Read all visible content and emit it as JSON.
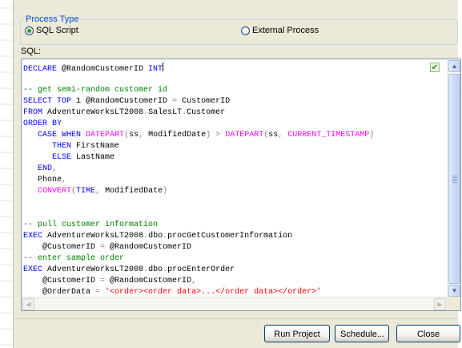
{
  "process_type": {
    "title": "Process Type",
    "options": [
      {
        "label": "SQL Script",
        "selected": true
      },
      {
        "label": "External Process",
        "selected": false
      }
    ]
  },
  "sql_label": "SQL:",
  "editor": {
    "lines": [
      [
        [
          "DECLARE",
          "kw"
        ],
        [
          " @RandomCustomerID ",
          ""
        ],
        [
          "INT",
          "kw"
        ]
      ],
      [],
      [
        [
          "-- get semi-random customer id",
          "cm"
        ]
      ],
      [
        [
          "SELECT TOP",
          "kw"
        ],
        [
          " 1 @RandomCustomerID ",
          ""
        ],
        [
          "=",
          "op"
        ],
        [
          " CustomerID",
          ""
        ]
      ],
      [
        [
          "FROM",
          "kw"
        ],
        [
          " AdventureWorksLT2008",
          ""
        ],
        [
          ".",
          "op"
        ],
        [
          "SalesLT",
          ""
        ],
        [
          ".",
          "op"
        ],
        [
          "Customer",
          ""
        ]
      ],
      [
        [
          "ORDER BY",
          "kw"
        ]
      ],
      [
        [
          "   ",
          ""
        ],
        [
          "CASE WHEN",
          "kw"
        ],
        [
          " ",
          ""
        ],
        [
          "DATEPART",
          "fn"
        ],
        [
          "(",
          "op"
        ],
        [
          "ss",
          ""
        ],
        [
          ",",
          "op"
        ],
        [
          " ModifiedDate",
          ""
        ],
        [
          ")",
          "op"
        ],
        [
          " ",
          ""
        ],
        [
          ">",
          "op"
        ],
        [
          " ",
          ""
        ],
        [
          "DATEPART",
          "fn"
        ],
        [
          "(",
          "op"
        ],
        [
          "ss",
          ""
        ],
        [
          ",",
          "op"
        ],
        [
          " ",
          ""
        ],
        [
          "CURRENT_TIMESTAMP",
          "fn"
        ],
        [
          ")",
          "op"
        ]
      ],
      [
        [
          "      ",
          ""
        ],
        [
          "THEN",
          "kw"
        ],
        [
          " FirstName",
          ""
        ]
      ],
      [
        [
          "      ",
          ""
        ],
        [
          "ELSE",
          "kw"
        ],
        [
          " LastName",
          ""
        ]
      ],
      [
        [
          "   ",
          ""
        ],
        [
          "END",
          "kw"
        ],
        [
          ",",
          "op"
        ]
      ],
      [
        [
          "   Phone",
          ""
        ],
        [
          ",",
          "op"
        ]
      ],
      [
        [
          "   ",
          ""
        ],
        [
          "CONVERT",
          "fn"
        ],
        [
          "(",
          "op"
        ],
        [
          "TIME",
          "kw"
        ],
        [
          ",",
          "op"
        ],
        [
          " ModifiedDate",
          ""
        ],
        [
          ")",
          "op"
        ]
      ],
      [],
      [],
      [
        [
          "-- pull customer information",
          "cm"
        ]
      ],
      [
        [
          "EXEC",
          "kw"
        ],
        [
          " AdventureWorksLT2008",
          ""
        ],
        [
          ".",
          "op"
        ],
        [
          "dbo",
          ""
        ],
        [
          ".",
          "op"
        ],
        [
          "procGetCustomerInformation",
          ""
        ]
      ],
      [
        [
          "    @CustomerID ",
          ""
        ],
        [
          "=",
          "op"
        ],
        [
          " @RandomCustomerID",
          ""
        ]
      ],
      [
        [
          "-- enter sample order",
          "cm"
        ]
      ],
      [
        [
          "EXEC",
          "kw"
        ],
        [
          " AdventureWorksLT2008",
          ""
        ],
        [
          ".",
          "op"
        ],
        [
          "dbo",
          ""
        ],
        [
          ".",
          "op"
        ],
        [
          "procEnterOrder",
          ""
        ]
      ],
      [
        [
          "    @CustomerID ",
          ""
        ],
        [
          "=",
          "op"
        ],
        [
          " @RandomCustomerID",
          ""
        ],
        [
          ",",
          "op"
        ]
      ],
      [
        [
          "    @OrderData ",
          ""
        ],
        [
          "=",
          "op"
        ],
        [
          " ",
          ""
        ],
        [
          "'<order><order data>...</order data></order>'",
          "st"
        ]
      ]
    ],
    "check_icon": "validation-check-icon",
    "scroll_up_icon": "chevron-up-icon",
    "scroll_down_icon": "chevron-down-icon",
    "scroll_left_icon": "chevron-left-icon",
    "scroll_right_icon": "chevron-right-icon"
  },
  "buttons": {
    "run_project": "Run Project",
    "schedule": "Schedule...",
    "close": "Close"
  },
  "colors": {
    "keyword": "#0000ff",
    "comment": "#008000",
    "operator": "#808080",
    "function": "#ff00ff",
    "string": "#ff0000",
    "group_title": "#0046d5"
  }
}
